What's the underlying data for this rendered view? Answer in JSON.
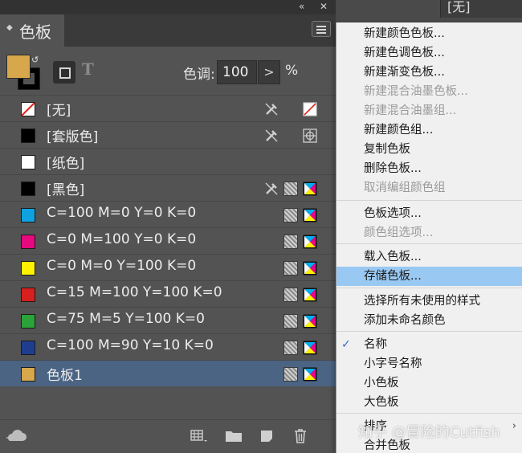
{
  "topbar": {
    "collapse": "«",
    "close": "✕"
  },
  "behind_window": {
    "label": "[无]"
  },
  "panel": {
    "tab_label": "色板",
    "tint_label": "色调:",
    "tint_value": "100",
    "tint_arrow": ">",
    "tint_unit": "%",
    "text_toggle": "T"
  },
  "colors": {
    "fill": "#d7a74b",
    "selected_row": "#4b6483",
    "menu_hover": "#99c9f2"
  },
  "swatches": [
    {
      "name": "[无]",
      "chip": "none",
      "icons": [
        "no-edit",
        "registration-none"
      ]
    },
    {
      "name": "[套版色]",
      "chip": "#000000",
      "icons": [
        "no-edit",
        "registration"
      ]
    },
    {
      "name": "[纸色]",
      "chip": "#ffffff",
      "icons": []
    },
    {
      "name": "[黑色]",
      "chip": "#000000",
      "icons": [
        "no-edit",
        "process",
        "cmyk"
      ]
    },
    {
      "name": "C=100 M=0 Y=0 K=0",
      "chip": "#0ea3e0",
      "icons": [
        "process",
        "cmyk"
      ]
    },
    {
      "name": "C=0 M=100 Y=0 K=0",
      "chip": "#e5087f",
      "icons": [
        "process",
        "cmyk"
      ]
    },
    {
      "name": "C=0 M=0 Y=100 K=0",
      "chip": "#fff100",
      "icons": [
        "process",
        "cmyk"
      ]
    },
    {
      "name": "C=15 M=100 Y=100 K=0",
      "chip": "#d6201f",
      "icons": [
        "process",
        "cmyk"
      ]
    },
    {
      "name": "C=75 M=5 Y=100 K=0",
      "chip": "#2ba33a",
      "icons": [
        "process",
        "cmyk"
      ]
    },
    {
      "name": "C=100 M=90 Y=10 K=0",
      "chip": "#1e3d8f",
      "icons": [
        "process",
        "cmyk"
      ]
    },
    {
      "name": "色板1",
      "chip": "#d7a74b",
      "icons": [
        "process",
        "cmyk"
      ],
      "selected": true
    }
  ],
  "menu": {
    "items": [
      {
        "label": "新建颜色色板..."
      },
      {
        "label": "新建色调色板..."
      },
      {
        "label": "新建渐变色板..."
      },
      {
        "label": "新建混合油墨色板...",
        "disabled": true
      },
      {
        "label": "新建混合油墨组...",
        "disabled": true
      },
      {
        "label": "新建颜色组..."
      },
      {
        "label": "复制色板"
      },
      {
        "label": "删除色板..."
      },
      {
        "label": "取消编组颜色组",
        "disabled": true
      },
      {
        "label": "色板选项..."
      },
      {
        "label": "颜色组选项...",
        "disabled": true
      },
      {
        "label": "载入色板..."
      },
      {
        "label": "存储色板...",
        "hover": true
      },
      {
        "label": "选择所有未使用的样式"
      },
      {
        "label": "添加未命名颜色"
      },
      {
        "label": "名称",
        "checked": true
      },
      {
        "label": "小字号名称"
      },
      {
        "label": "小色板"
      },
      {
        "label": "大色板"
      },
      {
        "label": "排序",
        "submenu": true
      },
      {
        "label": "合并色板"
      }
    ],
    "check_glyph": "✓",
    "submenu_glyph": "›"
  },
  "watermark": "知乎 @冒险的Cutfish"
}
